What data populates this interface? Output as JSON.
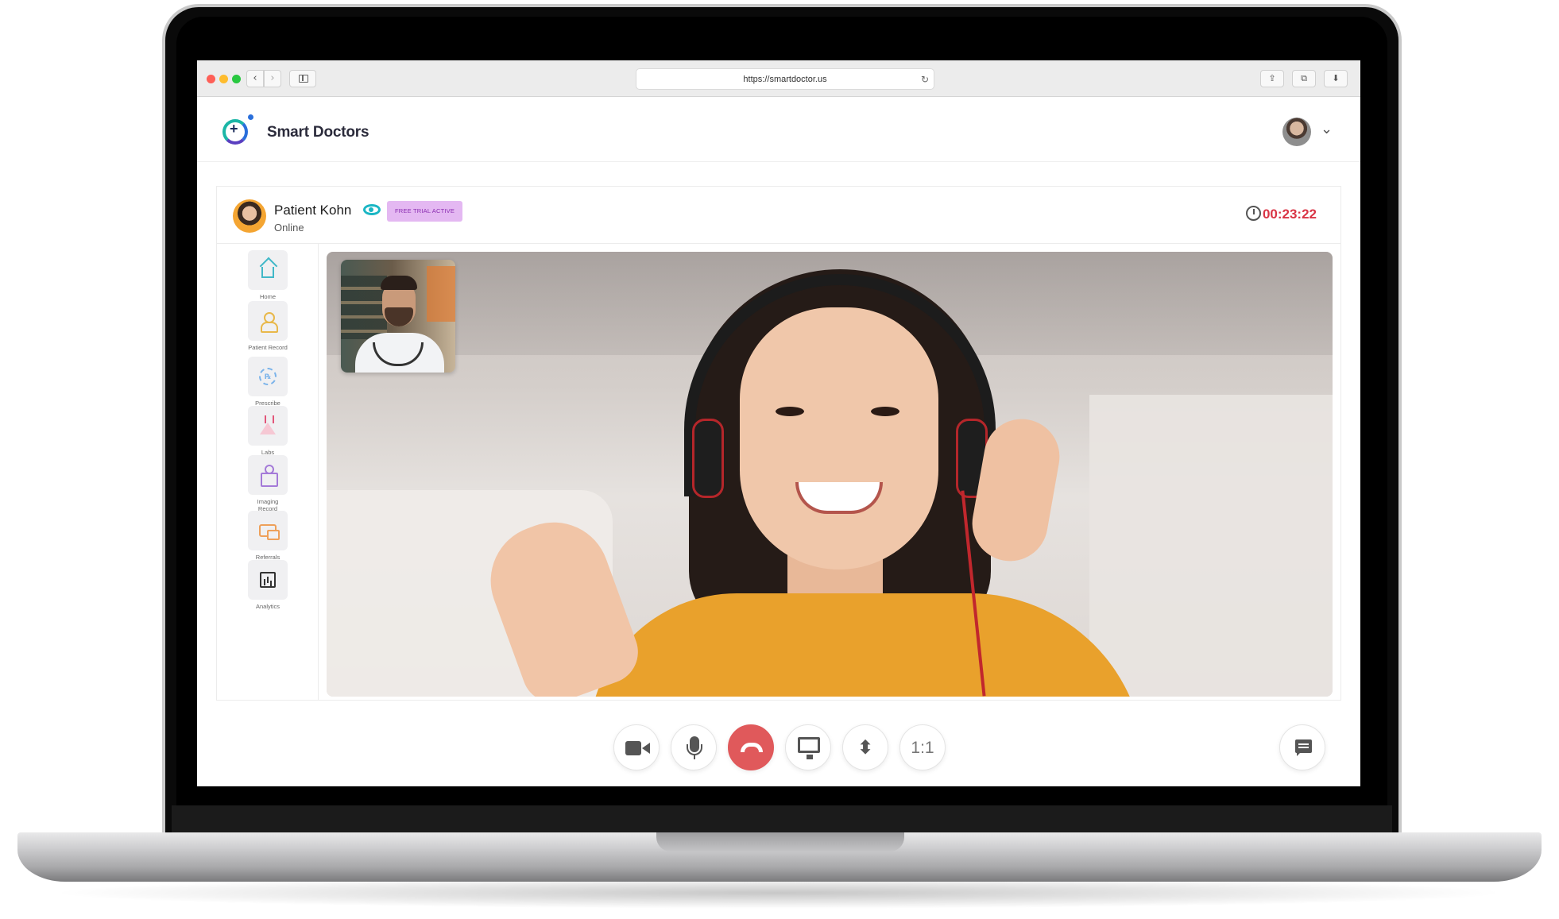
{
  "browser": {
    "url": "https://smartdoctor.us",
    "back_icon": "‹",
    "forward_icon": "›",
    "reload_icon": "↻",
    "share_icon": "⇪",
    "tabs_icon": "⧉",
    "download_icon": "⬇"
  },
  "header": {
    "brand": "Smart Doctors",
    "user_menu_icon": "⌄"
  },
  "patient": {
    "name": "Patient Kohn",
    "status": "Online",
    "badge": "FREE TRIAL ACTIVE",
    "timer": "00:23:22"
  },
  "nav": {
    "items": [
      {
        "label": "Home",
        "icon": "home-icon"
      },
      {
        "label": "Patient Record",
        "icon": "person-icon"
      },
      {
        "label": "Prescribe",
        "icon": "rx-icon"
      },
      {
        "label": "Labs",
        "icon": "flask-icon"
      },
      {
        "label": "Imaging Record",
        "icon": "imaging-icon"
      },
      {
        "label": "Referrals",
        "icon": "referral-icon"
      },
      {
        "label": "Analytics",
        "icon": "chart-icon"
      }
    ]
  },
  "controls": {
    "ratio": "1:1",
    "size_icon": "⬍",
    "end_call_color": "#e0595b"
  },
  "colors": {
    "accent_teal": "#1bb6c4",
    "timer_red": "#d93445",
    "badge_bg": "#e4b8f2"
  }
}
